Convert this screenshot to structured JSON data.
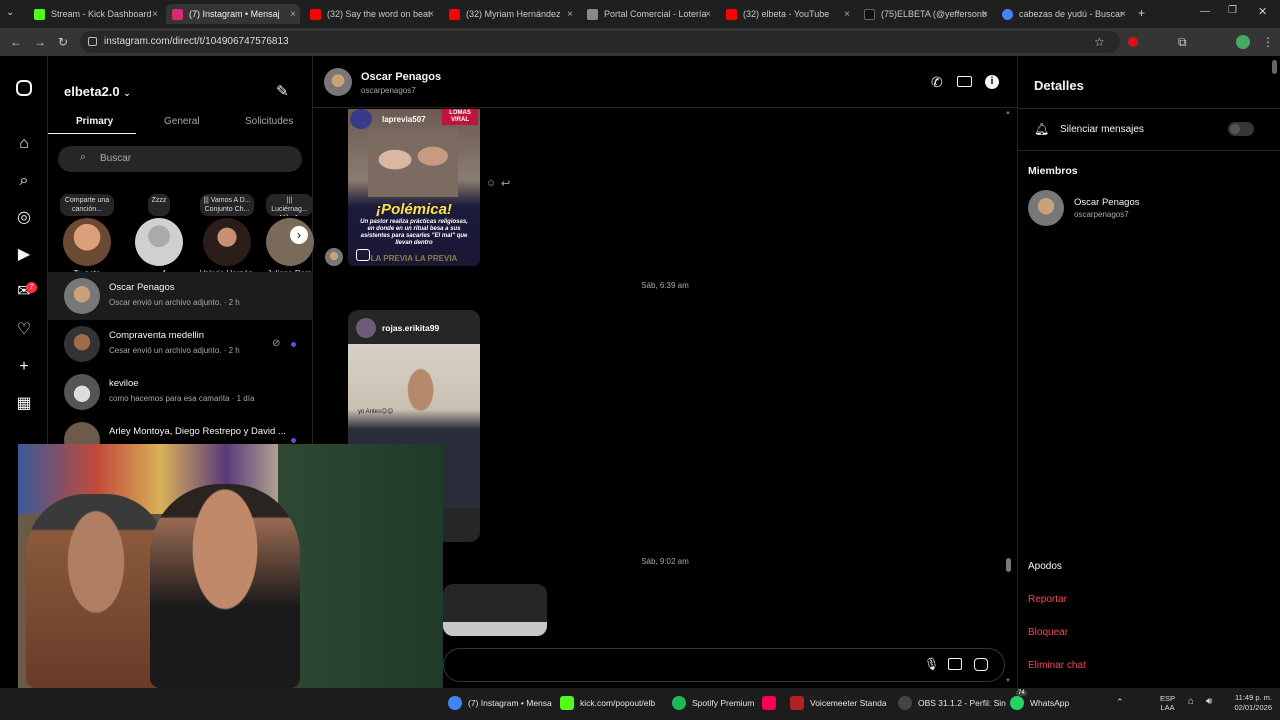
{
  "browser": {
    "tabs": [
      {
        "label": "Stream - Kick Dashboard",
        "color": "#53fc18"
      },
      {
        "label": "(7) Instagram • Mensaj",
        "color": "#d62976"
      },
      {
        "label": "(32) Say the word on beat",
        "color": "#ff0000"
      },
      {
        "label": "(32) Myriam Hernández",
        "color": "#ff0000"
      },
      {
        "label": "Portal Comercial - Lotería",
        "color": "#888888"
      },
      {
        "label": "(32) elbeta - YouTube",
        "color": "#ff0000"
      },
      {
        "label": "(75)ELBETA (@yeffersonb",
        "color": "#111111"
      },
      {
        "label": "cabezas de yudú - Buscar",
        "color": "#4285f4"
      }
    ],
    "url": "instagram.com/direct/t/104906747576813"
  },
  "inbox": {
    "username": "elbeta2.0",
    "tabs": [
      "Primary",
      "General",
      "Solicitudes"
    ],
    "search_placeholder": "Buscar",
    "notes": [
      {
        "bubble": "Comparte una canción...",
        "name": "Tu nota"
      },
      {
        "bubble": "Zzzz",
        "name": "𝒆𝒂𝒍"
      },
      {
        "bubble": "||| Vamos A D... Conjunto Ch...",
        "name": "Valeria Hernánd..."
      },
      {
        "bubble": "||| Luciérnag... Milo J, Silvio...",
        "name": "Juliana Ram"
      }
    ],
    "threads": [
      {
        "name": "Oscar Penagos",
        "preview": "Oscar envió un archivo adjunto. · 2 h"
      },
      {
        "name": "Compraventa medellin",
        "preview": "Cesar envió un archivo adjunto. · 2 h"
      },
      {
        "name": "keviloe",
        "preview": "como hacemos para esa camarita · 1 día"
      },
      {
        "name": "Arley Montoya, Diego Restrepo y David ...",
        "preview": ""
      }
    ]
  },
  "chat": {
    "contact_name": "Oscar Penagos",
    "contact_handle": "oscarpenagos7",
    "post1_user": "laprevia507",
    "post1_headline": "¡Polémica!",
    "post1_body": "Un pastor realiza prácticas religiosas, en donde en un ritual besa a sus asistentes para sacarles \"El mal\" que llevan dentro",
    "post1_badge": "LOMAS VIRAL",
    "post1_footer": "LA PREVIA LA PREVIA",
    "stamp1": "Sáb, 6:39 am",
    "post2_user": "rojas.erikita99",
    "post2_caption": "yo Antes😊😊",
    "stamp2": "Sáb, 9:02 am"
  },
  "details": {
    "title": "Detalles",
    "mute_label": "Silenciar mensajes",
    "members_label": "Miembros",
    "member_name": "Oscar Penagos",
    "member_handle": "oscarpenagos7",
    "nicknames": "Apodos",
    "report": "Reportar",
    "block": "Bloquear",
    "delete_chat": "Eliminar chat"
  },
  "taskbar": {
    "items": [
      {
        "label": "(7) Instagram • Mensa",
        "color": "#4285f4"
      },
      {
        "label": "kick.com/popout/elb",
        "color": "#53fc18"
      },
      {
        "label": "Spotify Premium",
        "color": "#1db954"
      },
      {
        "label": "",
        "color": "#ff0050"
      },
      {
        "label": "Voicemeeter Standa",
        "color": "#b22222"
      },
      {
        "label": "OBS 31.1.2 - Perfil: Sin",
        "color": "#444444"
      },
      {
        "label": "WhatsApp",
        "color": "#25d366"
      }
    ],
    "lang": "ESP",
    "lang2": "LAA",
    "time": "11:49 p. m.",
    "date": "02/01/2026",
    "badge": "74"
  }
}
